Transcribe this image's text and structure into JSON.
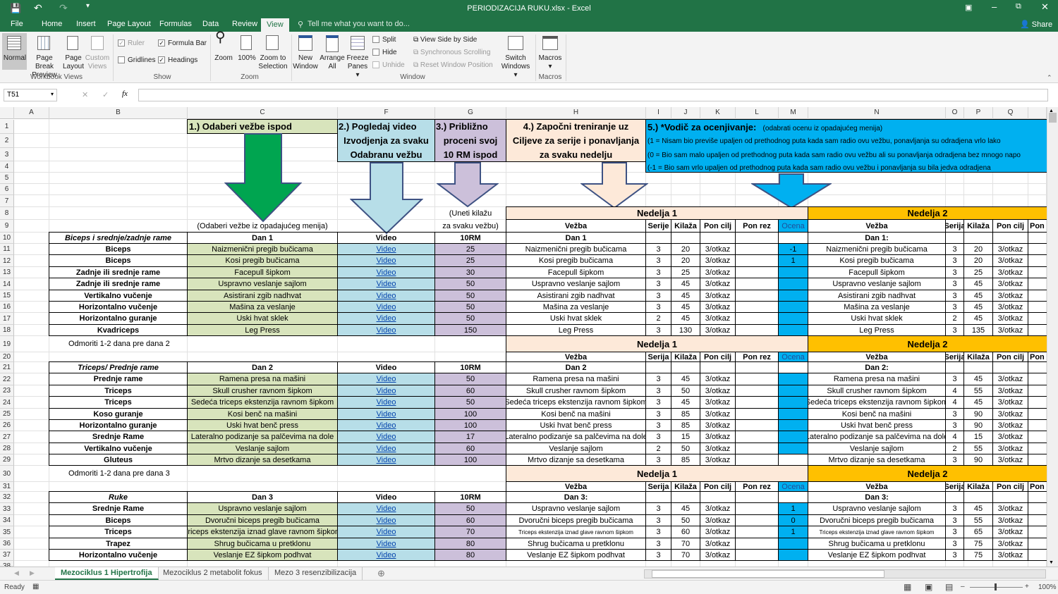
{
  "app": {
    "title": "PERIODIZACIJA RUKU.xlsx - Excel",
    "share": "Share"
  },
  "ribbon_tabs": [
    "File",
    "Home",
    "Insert",
    "Page Layout",
    "Formulas",
    "Data",
    "Review",
    "View"
  ],
  "active_tab": "View",
  "tell_me": "Tell me what you want to do...",
  "ribbon": {
    "workbook_views": {
      "label": "Workbook Views",
      "normal": "Normal",
      "page_break": "Page Break",
      "page_break2": "Preview",
      "page_layout": "Page",
      "page_layout2": "Layout",
      "custom": "Custom",
      "custom2": "Views"
    },
    "show": {
      "label": "Show",
      "ruler": "Ruler",
      "formula_bar": "Formula Bar",
      "gridlines": "Gridlines",
      "headings": "Headings",
      "ruler_checked": true,
      "formula_bar_checked": true,
      "gridlines_checked": false,
      "headings_checked": true
    },
    "zoom": {
      "label": "Zoom",
      "zoom": "Zoom",
      "hundred": "100%",
      "zoom_sel": "Zoom to",
      "zoom_sel2": "Selection"
    },
    "window": {
      "label": "Window",
      "new": "New",
      "new2": "Window",
      "arrange": "Arrange",
      "arrange2": "All",
      "freeze": "Freeze",
      "freeze2": "Panes",
      "split": "Split",
      "hide": "Hide",
      "unhide": "Unhide",
      "side": "View Side by Side",
      "sync": "Synchronous Scrolling",
      "reset": "Reset Window Position",
      "switch": "Switch",
      "switch2": "Windows"
    },
    "macros": {
      "label": "Macros",
      "macros": "Macros"
    }
  },
  "formula_bar": {
    "name_box": "T51",
    "formula": ""
  },
  "columns": [
    "A",
    "B",
    "C",
    "F",
    "G",
    "H",
    "I",
    "J",
    "K",
    "L",
    "M",
    "N",
    "O",
    "P",
    "Q"
  ],
  "rows": [
    "1",
    "2",
    "3",
    "4",
    "5",
    "6",
    "7",
    "8",
    "9",
    "10",
    "11",
    "12",
    "13",
    "14",
    "15",
    "16",
    "17",
    "18",
    "19",
    "20",
    "21",
    "22",
    "23",
    "24",
    "25",
    "26",
    "27",
    "28",
    "29",
    "30",
    "31",
    "32",
    "33",
    "34",
    "35",
    "36",
    "37",
    "38"
  ],
  "instructions": {
    "step1": "1.) Odaberi vežbe ispod",
    "step2": [
      "2.) Pogledaj video",
      "Izvodjenja za svaku",
      "Odabranu vežbu"
    ],
    "step3": [
      "3.) Približno",
      "proceni svoj",
      "10 RM ispod"
    ],
    "step4": [
      "4.) Započni treniranje uz",
      "Ciljeve za serije i ponavljanja",
      "za svaku nedelju"
    ],
    "step5_title": "5.) *Vodič za ocenjivanje:",
    "step5_note": "(odabrati ocenu iz opadajućeg menija)",
    "step5_lines": [
      "(1 = Nisam bio previše upaljen od prethodnog puta kada sam radio ovu vežbu, ponavljanja su odradjena vrlo lako",
      "(0 = Bio sam malo upaljen od prethodnog puta kada sam radio ovu vežbu ali su ponavljanja odradjena bez mnogo napo",
      "(-1 = Bio sam vrlo upaljen od prethodnog puta kada sam radio ovu vežbu i ponavljanja su bila jedva odradjena"
    ],
    "note_select": "(Odaberi vežbe iz opadajućeg menija)",
    "note_weight": [
      "(Uneti kilažu",
      "za svaku vežbu)"
    ]
  },
  "colors": {
    "green": "#d8e4bc",
    "video": "#b7dee8",
    "rm": "#ccc0da",
    "week1": "#fde9d9",
    "week2": "#ffc000",
    "ocena": "#00b0f0",
    "excel": "#217346"
  },
  "blocks": [
    {
      "group": "Biceps i srednje/zadnje rame",
      "day": "Dan 1",
      "video_h": "Video",
      "rm_h": "10RM",
      "rest": "Odmoriti 1-2 dana pre dana 2",
      "week1": {
        "title": "Nedelja 1",
        "cols": [
          "Vežba",
          "Serije",
          "Kilaža",
          "Pon cilj",
          "Pon rez",
          "Ocena"
        ],
        "day": "Dan 1"
      },
      "week2": {
        "title": "Nedelja 2",
        "cols": [
          "Vežba",
          "Serija",
          "Kilaža",
          "Pon cilj",
          "Pon r"
        ],
        "day": "Dan 1:"
      },
      "rows": [
        {
          "muscle": "Biceps",
          "exercise": "Naizmenični pregib bučicama",
          "video": "Video",
          "rm": "25",
          "w1": [
            "Naizmenični pregib bučicama",
            "3",
            "20",
            "3/otkaz",
            "",
            "-1"
          ],
          "w2": [
            "Naizmenični pregib bučicama",
            "3",
            "20",
            "3/otkaz",
            ""
          ]
        },
        {
          "muscle": "Biceps",
          "exercise": "Kosi pregib bučicama",
          "video": "Video",
          "rm": "25",
          "w1": [
            "Kosi pregib bučicama",
            "3",
            "20",
            "3/otkaz",
            "",
            "1"
          ],
          "w2": [
            "Kosi pregib bučicama",
            "3",
            "20",
            "3/otkaz",
            ""
          ]
        },
        {
          "muscle": "Zadnje ili srednje rame",
          "exercise": "Facepull šipkom",
          "video": "Video",
          "rm": "30",
          "w1": [
            "Facepull šipkom",
            "3",
            "25",
            "3/otkaz",
            "",
            ""
          ],
          "w2": [
            "Facepull šipkom",
            "3",
            "25",
            "3/otkaz",
            ""
          ]
        },
        {
          "muscle": "Zadnje ili srednje rame",
          "exercise": "Uspravno veslanje sajlom",
          "video": "Video",
          "rm": "50",
          "w1": [
            "Uspravno veslanje sajlom",
            "3",
            "45",
            "3/otkaz",
            "",
            ""
          ],
          "w2": [
            "Uspravno veslanje sajlom",
            "3",
            "45",
            "3/otkaz",
            ""
          ]
        },
        {
          "muscle": "Vertikalno vučenje",
          "exercise": "Asistirani zgib nadhvat",
          "video": "Video",
          "rm": "50",
          "w1": [
            "Asistirani zgib nadhvat",
            "3",
            "45",
            "3/otkaz",
            "",
            ""
          ],
          "w2": [
            "Asistirani zgib nadhvat",
            "3",
            "45",
            "3/otkaz",
            ""
          ]
        },
        {
          "muscle": "Horizontalno vučenje",
          "exercise": "Mašina za veslanje",
          "video": "Video",
          "rm": "50",
          "w1": [
            "Mašina za veslanje",
            "3",
            "45",
            "3/otkaz",
            "",
            ""
          ],
          "w2": [
            "Mašina za veslanje",
            "3",
            "45",
            "3/otkaz",
            ""
          ]
        },
        {
          "muscle": "Horizontalno guranje",
          "exercise": "Uski hvat sklek",
          "video": "Video",
          "rm": "50",
          "w1": [
            "Uski hvat sklek",
            "2",
            "45",
            "3/otkaz",
            "",
            ""
          ],
          "w2": [
            "Uski hvat sklek",
            "2",
            "45",
            "3/otkaz",
            ""
          ]
        },
        {
          "muscle": "Kvadriceps",
          "exercise": "Leg Press",
          "video": "Video",
          "rm": "150",
          "w1": [
            "Leg Press",
            "3",
            "130",
            "3/otkaz",
            "",
            ""
          ],
          "w2": [
            "Leg Press",
            "3",
            "135",
            "3/otkaz",
            ""
          ]
        }
      ]
    },
    {
      "group": "Triceps/ Prednje rame",
      "day": "Dan 2",
      "video_h": "Video",
      "rm_h": "10RM",
      "rest": "Odmoriti 1-2 dana pre dana 3",
      "week1": {
        "title": "Nedelja 1",
        "cols": [
          "Vežba",
          "Serija",
          "Kilaža",
          "Pon cilj",
          "Pon rez",
          "Ocena"
        ],
        "day": "Dan 2"
      },
      "week2": {
        "title": "Nedelja 2",
        "cols": [
          "Vežba",
          "Serija",
          "Kilaža",
          "Pon cilj",
          "Pon r"
        ],
        "day": "Dan 2:"
      },
      "rows": [
        {
          "muscle": "Prednje rame",
          "exercise": "Ramena presa na mašini",
          "video": "Video",
          "rm": "50",
          "w1": [
            "Ramena presa na mašini",
            "3",
            "45",
            "3/otkaz",
            "",
            ""
          ],
          "w2": [
            "Ramena presa na mašini",
            "3",
            "45",
            "3/otkaz",
            ""
          ]
        },
        {
          "muscle": "Triceps",
          "exercise": "Skull crusher ravnom šipkom",
          "video": "Video",
          "rm": "60",
          "w1": [
            "Skull crusher ravnom šipkom",
            "3",
            "50",
            "3/otkaz",
            "",
            ""
          ],
          "w2": [
            "Skull crusher ravnom šipkom",
            "4",
            "55",
            "3/otkaz",
            ""
          ]
        },
        {
          "muscle": "Triceps",
          "exercise": "Sedeća triceps ekstenzija ravnom šipkom",
          "video": "Video",
          "rm": "50",
          "w1": [
            "Sedeća triceps ekstenzija ravnom šipkom",
            "3",
            "45",
            "3/otkaz",
            "",
            ""
          ],
          "w2": [
            "Sedeća triceps ekstenzija ravnom šipkom",
            "4",
            "45",
            "3/otkaz",
            ""
          ]
        },
        {
          "muscle": "Koso guranje",
          "exercise": "Kosi benč na mašini",
          "video": "Video",
          "rm": "100",
          "w1": [
            "Kosi benč na mašini",
            "3",
            "85",
            "3/otkaz",
            "",
            ""
          ],
          "w2": [
            "Kosi benč na mašini",
            "3",
            "90",
            "3/otkaz",
            ""
          ]
        },
        {
          "muscle": "Horizontalno guranje",
          "exercise": "Uski hvat benč press",
          "video": "Video",
          "rm": "100",
          "w1": [
            "Uski hvat benč press",
            "3",
            "85",
            "3/otkaz",
            "",
            ""
          ],
          "w2": [
            "Uski hvat benč press",
            "3",
            "90",
            "3/otkaz",
            ""
          ]
        },
        {
          "muscle": "Srednje Rame",
          "exercise": "Lateralno podizanje sa palčevima na dole",
          "video": "Video",
          "rm": "17",
          "w1": [
            "Lateralno podizanje sa palčevima na dole",
            "3",
            "15",
            "3/otkaz",
            "",
            ""
          ],
          "w2": [
            "Lateralno podizanje sa palčevima na dole",
            "4",
            "15",
            "3/otkaz",
            ""
          ]
        },
        {
          "muscle": "Vertikalno vučenje",
          "exercise": "Veslanje sajlom",
          "video": "Video",
          "rm": "60",
          "w1": [
            "Veslanje sajlom",
            "2",
            "50",
            "3/otkaz",
            "",
            ""
          ],
          "w2": [
            "Veslanje sajlom",
            "2",
            "55",
            "3/otkaz",
            ""
          ]
        },
        {
          "muscle": "Gluteus",
          "exercise": "Mrtvo dizanje sa desetkama",
          "video": "Video",
          "rm": "100",
          "w1": [
            "Mrtvo dizanje sa desetkama",
            "3",
            "85",
            "3/otkaz",
            "",
            ""
          ],
          "w2": [
            "Mrtvo dizanje sa desetkama",
            "3",
            "90",
            "3/otkaz",
            ""
          ]
        }
      ]
    },
    {
      "group": "Ruke",
      "day": "Dan 3",
      "video_h": "Video",
      "rm_h": "10RM",
      "rest": "",
      "week1": {
        "title": "Nedelja 1",
        "cols": [
          "Vežba",
          "Serija",
          "Kilaža",
          "Pon cilj",
          "Pon rez",
          "Ocena"
        ],
        "day": "Dan 3:"
      },
      "week2": {
        "title": "Nedelja 2",
        "cols": [
          "Vežba",
          "Serija",
          "Kilaža",
          "Pon cilj",
          "Pon r"
        ],
        "day": "Dan 3:"
      },
      "rows": [
        {
          "muscle": "Srednje Rame",
          "exercise": "Uspravno veslanje sajlom",
          "video": "Video",
          "rm": "50",
          "w1": [
            "Uspravno veslanje sajlom",
            "3",
            "45",
            "3/otkaz",
            "",
            "1"
          ],
          "w2": [
            "Uspravno veslanje sajlom",
            "3",
            "45",
            "3/otkaz",
            ""
          ]
        },
        {
          "muscle": "Biceps",
          "exercise": "Dvoručni biceps pregib bučicama",
          "video": "Video",
          "rm": "60",
          "w1": [
            "Dvoručni biceps pregib bučicama",
            "3",
            "50",
            "3/otkaz",
            "",
            "0"
          ],
          "w2": [
            "Dvoručni biceps pregib bučicama",
            "3",
            "55",
            "3/otkaz",
            ""
          ]
        },
        {
          "muscle": "Triceps",
          "exercise": "Triceps ekstenzija iznad glave ravnom šipkom",
          "video": "Video",
          "rm": "70",
          "w1": [
            "Triceps ekstenzija iznad glave ravnom šipkom",
            "3",
            "60",
            "3/otkaz",
            "",
            "1"
          ],
          "w2": [
            "Triceps ekstenzija iznad glave ravnom šipkom",
            "3",
            "65",
            "3/otkaz",
            ""
          ]
        },
        {
          "muscle": "Trapez",
          "exercise": "Shrug bučicama u pretklonu",
          "video": "Video",
          "rm": "80",
          "w1": [
            "Shrug bučicama u pretklonu",
            "3",
            "70",
            "3/otkaz",
            "",
            ""
          ],
          "w2": [
            "Shrug bučicama u pretklonu",
            "3",
            "75",
            "3/otkaz",
            ""
          ]
        },
        {
          "muscle": "Horizontalno vučenje",
          "exercise": "Veslanje EZ šipkom podhvat",
          "video": "Video",
          "rm": "80",
          "w1": [
            "Veslanje EZ šipkom podhvat",
            "3",
            "70",
            "3/otkaz",
            "",
            ""
          ],
          "w2": [
            "Veslanje EZ šipkom podhvat",
            "3",
            "75",
            "3/otkaz",
            ""
          ]
        }
      ]
    }
  ],
  "sheet_tabs": [
    "Mezociklus 1 Hipertrofija",
    "Mezociklus 2 metabolit fokus",
    "Mezo 3 resenzibilizacija"
  ],
  "active_sheet": 0,
  "status": {
    "ready": "Ready",
    "zoom": "100%"
  }
}
